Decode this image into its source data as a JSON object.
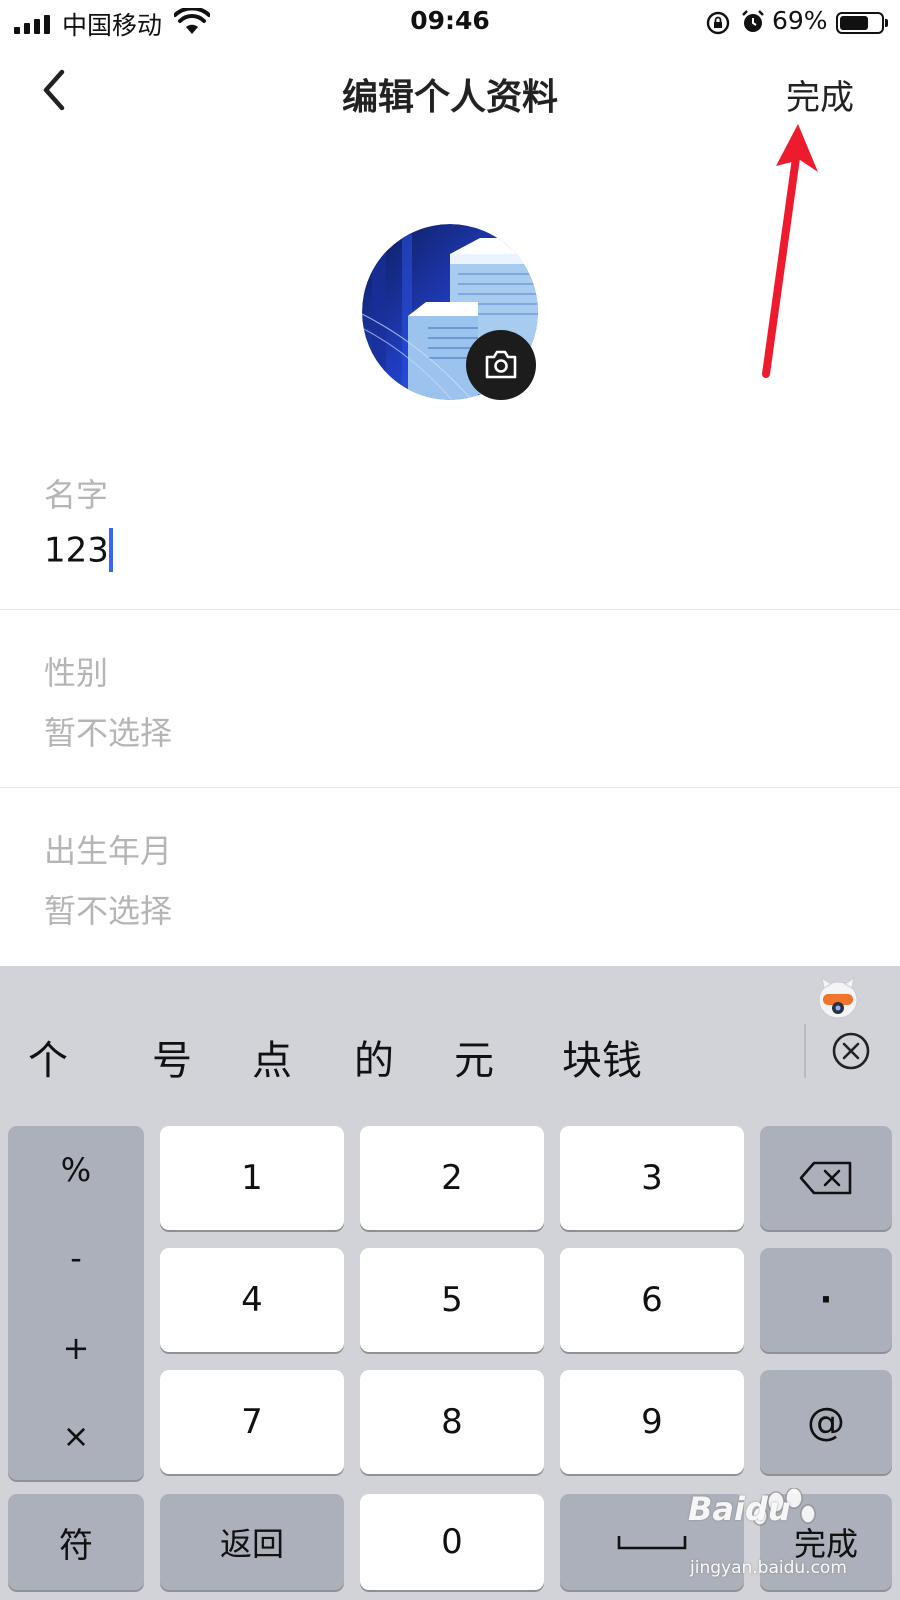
{
  "status_bar": {
    "carrier": "中国移动",
    "time": "09:46",
    "battery_percent": "69%",
    "battery_level": 0.69,
    "icons": [
      "signal-icon",
      "wifi-icon",
      "rotation-lock-icon",
      "alarm-icon",
      "battery-icon"
    ]
  },
  "nav": {
    "title": "编辑个人资料",
    "done_label": "完成",
    "back_icon": "chevron-left-icon"
  },
  "avatar": {
    "camera_icon": "camera-icon"
  },
  "form": {
    "name_label": "名字",
    "name_value": "123",
    "gender_label": "性别",
    "gender_value": "暂不选择",
    "birth_label": "出生年月",
    "birth_value": "暂不选择"
  },
  "keyboard": {
    "candidates": [
      "个",
      "号",
      "点",
      "的",
      "元",
      "块钱"
    ],
    "clear_icon": "clear-circle-icon",
    "symbols": [
      "%",
      "-",
      "+",
      "×"
    ],
    "digits": [
      "1",
      "2",
      "3",
      "4",
      "5",
      "6",
      "7",
      "8",
      "9",
      "0"
    ],
    "dot_key": "·",
    "at_key": "@",
    "fu_key": "符",
    "back_key": "返回",
    "done_key": "完成",
    "backspace_icon": "backspace-icon",
    "space_icon": "space-bar-icon"
  },
  "watermark": {
    "brand": "Baidu",
    "site": "jingyan.baidu.com"
  },
  "colors": {
    "caret": "#3b63f5",
    "annotation_arrow": "#ee1b2e",
    "keyboard_bg": "#d1d3d9",
    "function_key": "#acb0bb"
  }
}
